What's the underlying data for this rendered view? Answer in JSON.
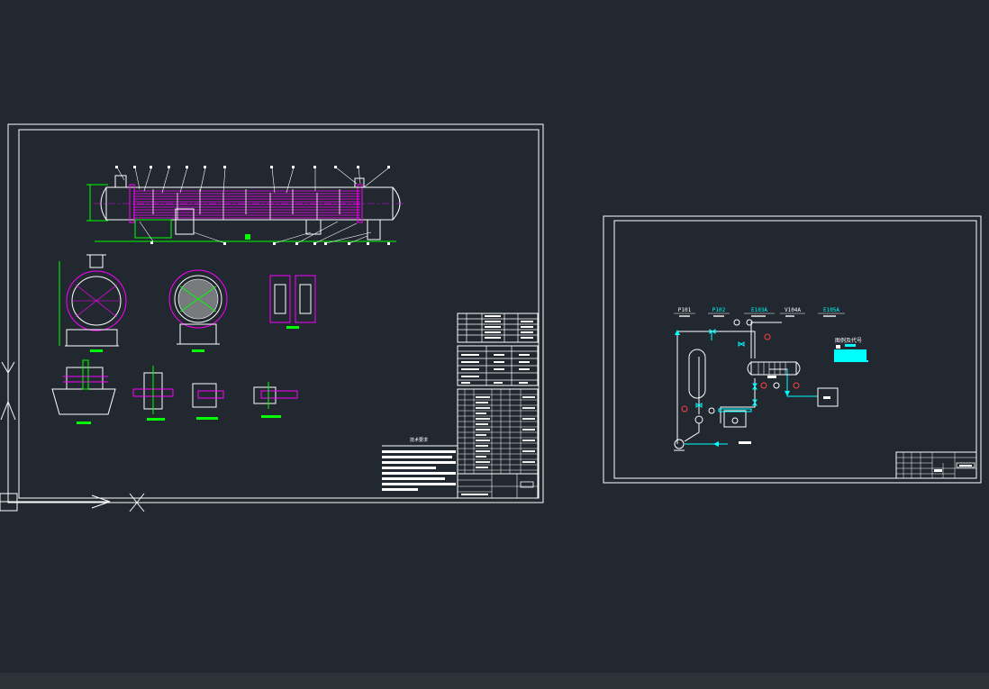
{
  "app": {
    "background": "#212830",
    "statusbar_color": "#2e333a"
  },
  "colors": {
    "frame": "#ffffff",
    "geometry": "#ffffff",
    "shell_hatch": "#ff00ff",
    "centerline": "#ff00ff",
    "dimension": "#00ff00",
    "detail_label": "#00ff00",
    "flow_line": "#00ffff",
    "tag_text": "#00ffff",
    "valve": "#ff4040"
  },
  "left_sheet": {
    "notes_title": "技术要求"
  },
  "right_sheet": {
    "tags": [
      {
        "label": "P101",
        "color": "#ffffff"
      },
      {
        "label": "P102",
        "color": "#00ffff"
      },
      {
        "label": "E103A",
        "color": "#00ffff"
      },
      {
        "label": "V104A",
        "color": "#ffffff"
      },
      {
        "label": "E105A",
        "color": "#00ffff"
      }
    ],
    "legend_title": "图例及代号"
  }
}
